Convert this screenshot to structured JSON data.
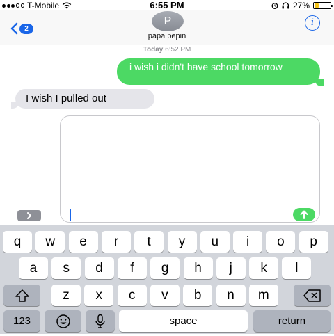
{
  "status_bar": {
    "carrier": "T-Mobile",
    "time": "6:55 PM",
    "battery_percent": "27%",
    "battery_level": 0.27,
    "signal_filled": 3,
    "signal_total": 5
  },
  "header": {
    "back_badge": "2",
    "avatar_initial": "P",
    "contact_name": "papa pepin",
    "info_glyph": "i"
  },
  "conversation": {
    "timestamp_day": "Today",
    "timestamp_time": "6:52 PM",
    "messages": [
      {
        "direction": "outgoing",
        "text": "i wish i didn't have school tomorrow"
      },
      {
        "direction": "incoming",
        "text": "I wish I pulled out"
      }
    ]
  },
  "compose": {
    "value": "",
    "expand_icon": "chevron-right-icon",
    "send_icon": "arrow-up-icon"
  },
  "keyboard": {
    "row1": [
      "q",
      "w",
      "e",
      "r",
      "t",
      "y",
      "u",
      "i",
      "o",
      "p"
    ],
    "row2": [
      "a",
      "s",
      "d",
      "f",
      "g",
      "h",
      "j",
      "k",
      "l"
    ],
    "row3": [
      "z",
      "x",
      "c",
      "v",
      "b",
      "n",
      "m"
    ],
    "numbers_label": "123",
    "space_label": "space",
    "return_label": "return",
    "shift_icon": "shift-icon",
    "delete_icon": "backspace-icon",
    "emoji_icon": "emoji-icon",
    "mic_icon": "microphone-icon"
  },
  "colors": {
    "accent_blue": "#1a66e8",
    "imessage_green": "#4cd964",
    "incoming_gray": "#e5e5ea",
    "keyboard_bg": "#d2d5db"
  }
}
